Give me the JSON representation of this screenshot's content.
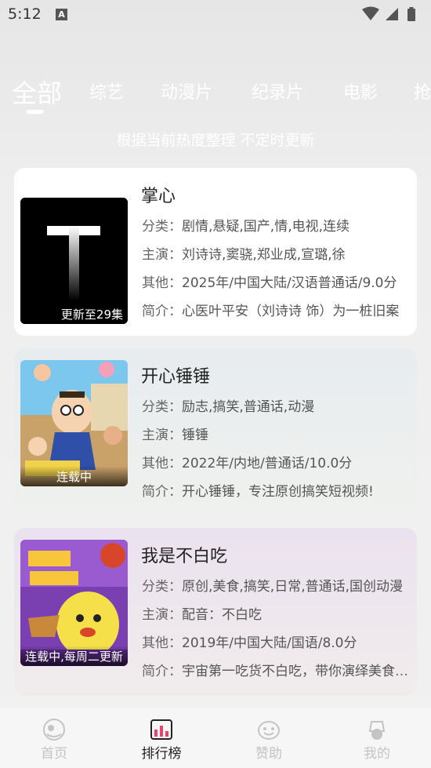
{
  "status": {
    "time": "5:12",
    "indicator": "A"
  },
  "tabs": [
    {
      "label": "全部",
      "active": true
    },
    {
      "label": "综艺"
    },
    {
      "label": "动漫片"
    },
    {
      "label": "纪录片"
    },
    {
      "label": "电影"
    },
    {
      "label": "抢"
    }
  ],
  "subtitle": "根据当前热度整理 不定时更新",
  "labels": {
    "category": "分类：",
    "cast": "主演：",
    "other": "其他：",
    "intro": "简介："
  },
  "cards": [
    {
      "title": "掌心",
      "badge": "更新至29集",
      "category": "剧情,悬疑,国产,情,电视,连续",
      "cast": "刘诗诗,窦骁,郑业成,宣璐,徐",
      "other": "2025年/中国大陆/汉语普通话/9.0分",
      "intro": "心医叶平安（刘诗诗 饰）为一桩旧案"
    },
    {
      "title": "开心锤锤",
      "badge": "连载中",
      "category": "励志,搞笑,普通话,动漫",
      "cast": "锤锤",
      "other": "2022年/内地/普通话/10.0分",
      "intro": "开心锤锤，专注原创搞笑短视频!"
    },
    {
      "title": "我是不白吃",
      "badge": "连载中,每周二更新",
      "category": "原创,美食,搞笑,日常,普通话,国创动漫",
      "cast": "配音：不白吃",
      "other": "2019年/中国大陆/国语/8.0分",
      "intro": "宇宙第一吃货不白吃，带你演绎美食背后的故事"
    }
  ],
  "nav": [
    {
      "label": "首页",
      "icon": "home-icon",
      "active": false
    },
    {
      "label": "排行榜",
      "icon": "ranking-icon",
      "active": true
    },
    {
      "label": "赞助",
      "icon": "sponsor-icon",
      "active": false
    },
    {
      "label": "我的",
      "icon": "profile-icon",
      "active": false
    }
  ]
}
